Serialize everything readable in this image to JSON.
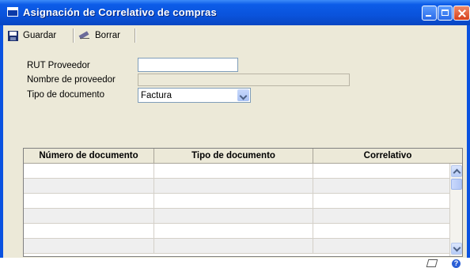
{
  "window": {
    "title": "Asignación de Correlativo de compras"
  },
  "toolbar": {
    "save_label": "Guardar",
    "clear_label": "Borrar"
  },
  "form": {
    "rut_label": "RUT Proveedor",
    "rut_value": "",
    "nombre_label": "Nombre de proveedor",
    "nombre_value": "",
    "tipo_label": "Tipo de documento",
    "tipo_value": "Factura"
  },
  "grid": {
    "columns": [
      "Número de documento",
      "Tipo de documento",
      "Correlativo"
    ],
    "rows": [
      [
        "",
        "",
        ""
      ],
      [
        "",
        "",
        ""
      ],
      [
        "",
        "",
        ""
      ],
      [
        "",
        "",
        ""
      ],
      [
        "",
        "",
        ""
      ],
      [
        "",
        "",
        ""
      ]
    ]
  },
  "icons": {
    "app": "window-app-icon",
    "save": "floppy-disk-icon",
    "clear": "eraser-icon",
    "note": "note-icon",
    "help": "help-icon"
  },
  "colors": {
    "titlebar": "#0a53dc",
    "form_bg": "#ece9d8"
  }
}
